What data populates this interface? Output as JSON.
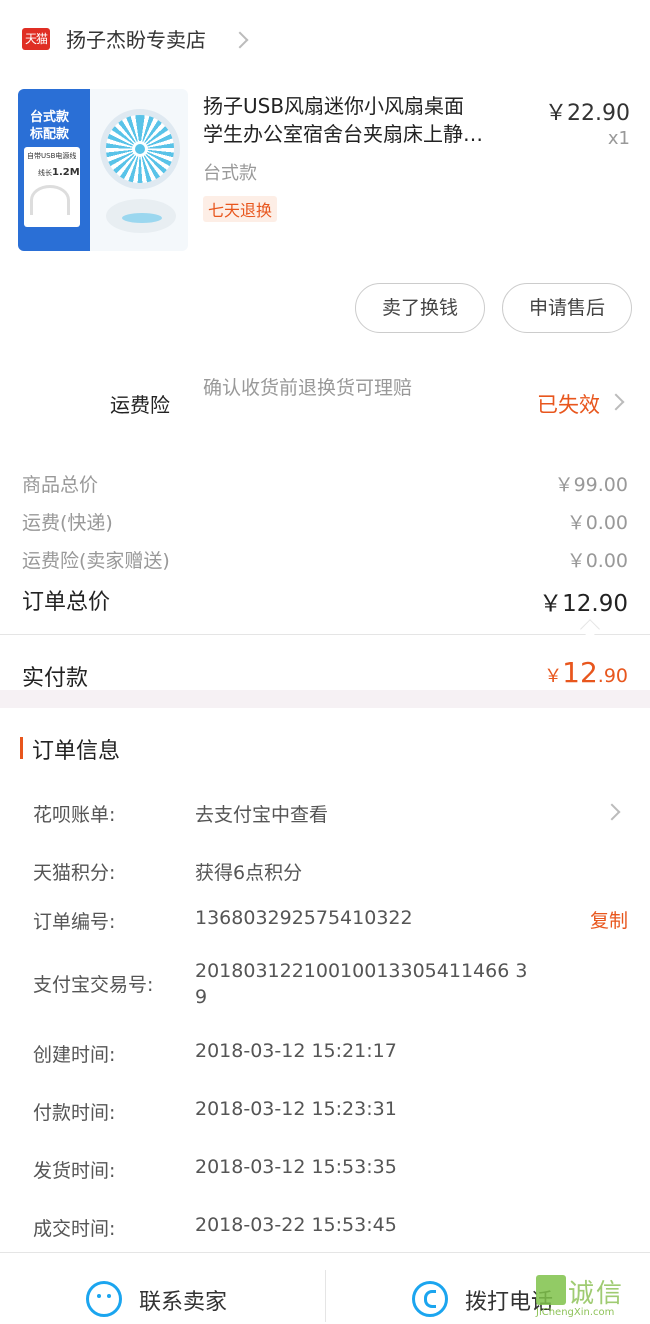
{
  "store": {
    "logo_text": "天猫",
    "name": "扬子杰盼专卖店"
  },
  "product": {
    "image_text": [
      "台式款",
      "标配款"
    ],
    "image_cable_label": "自带USB电源线",
    "image_length_label": "线长",
    "image_length_value": "1.2M",
    "title_line1": "扬子USB风扇迷你小风扇桌面",
    "title_line2": "学生办公室宿舍台夹扇床上静…",
    "price": "￥22.90",
    "quantity": "x1",
    "spec": "台式款",
    "tag": "七天退换"
  },
  "actions": {
    "sell_label": "卖了换钱",
    "after_sale_label": "申请售后"
  },
  "insurance": {
    "label": "运费险",
    "desc": "确认收货前退换货可理赔",
    "status": "已失效"
  },
  "amounts": {
    "rows": [
      {
        "label": "商品总价",
        "value": "￥99.00"
      },
      {
        "label": "运费(快递)",
        "value": "￥0.00"
      },
      {
        "label": "运费险(卖家赠送)",
        "value": "￥0.00"
      }
    ],
    "total_label": "订单总价",
    "total_value": "￥12.90",
    "paid_label": "实付款",
    "paid_symbol": "￥",
    "paid_int": "12",
    "paid_dec": ".90"
  },
  "order_info": {
    "title": "订单信息",
    "huabei_label": "花呗账单:",
    "huabei_value": "去支付宝中查看",
    "points_label": "天猫积分:",
    "points_value": "获得6点积分",
    "order_no_label": "订单编号:",
    "order_no_value": "136803292575410322",
    "copy_label": "复制",
    "alipay_label": "支付宝交易号:",
    "alipay_line1": "20180312210010013305411466 3",
    "alipay_line2": "9",
    "created_label": "创建时间:",
    "created_value": "2018-03-12 15:21:17",
    "paid_label": "付款时间:",
    "paid_value": "2018-03-12 15:23:31",
    "shipped_label": "发货时间:",
    "shipped_value": "2018-03-12 15:53:35",
    "completed_label": "成交时间:",
    "completed_value": "2018-03-22 15:53:45"
  },
  "bottom": {
    "contact_label": "联系卖家",
    "call_label": "拨打电话"
  },
  "watermark": {
    "text": "诚信",
    "url": "JiChengXin.com"
  },
  "colors": {
    "accent": "#e8561d",
    "brand_red": "#e02e24",
    "icon_blue": "#1ba5ef"
  }
}
